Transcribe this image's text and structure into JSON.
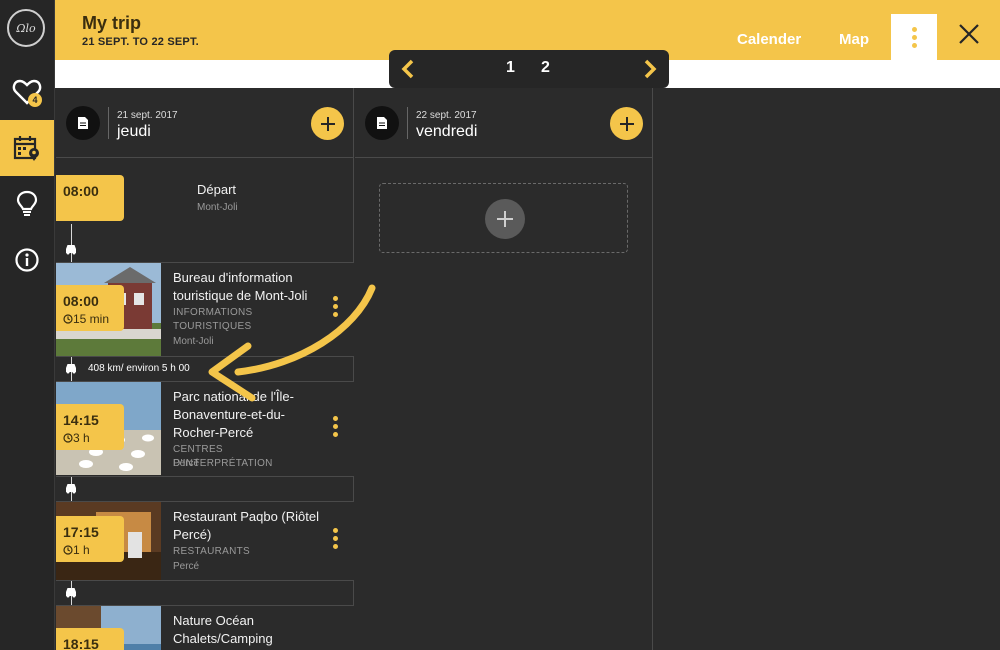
{
  "header": {
    "title": "My trip",
    "dates": "21 SEPT. TO 22 SEPT.",
    "calendar_label": "Calender",
    "map_label": "Map"
  },
  "sidebar": {
    "logo_text": "Ωlo",
    "favorites_count": "4",
    "items": [
      {
        "icon": "heart-icon"
      },
      {
        "icon": "calendar-pin-icon",
        "active": true
      },
      {
        "icon": "lightbulb-icon"
      },
      {
        "icon": "info-icon"
      }
    ]
  },
  "pager": {
    "pages": [
      "1",
      "2"
    ]
  },
  "days": [
    {
      "date": "21 sept. 2017",
      "day": "jeudi",
      "departure": {
        "time": "08:00",
        "label": "Départ",
        "city": "Mont-Joli"
      },
      "items": [
        {
          "time": "08:00",
          "duration": "15 min",
          "title": "Bureau d'information touristique de Mont-Joli",
          "category": "INFORMATIONS TOURISTIQUES",
          "city": "Mont-Joli"
        },
        {
          "time": "14:15",
          "duration": "3 h",
          "title": "Parc national de l'Île-Bonaventure-et-du-Rocher-Percé",
          "category": "CENTRES D'INTERPRÉTATION",
          "city": "Percé"
        },
        {
          "time": "17:15",
          "duration": "1 h",
          "title": "Restaurant Paqbo (Riôtel Percé)",
          "category": "RESTAURANTS",
          "city": "Percé"
        },
        {
          "time": "18:15",
          "duration": "",
          "title": "Nature Océan Chalets/Camping",
          "category": "",
          "city": ""
        }
      ],
      "travel": [
        "408 km/ environ 5 h 00"
      ]
    },
    {
      "date": "22 sept. 2017",
      "day": "vendredi"
    }
  ],
  "colors": {
    "accent": "#f4c54a",
    "background": "#2b2b2b",
    "sidebar": "#262626"
  }
}
